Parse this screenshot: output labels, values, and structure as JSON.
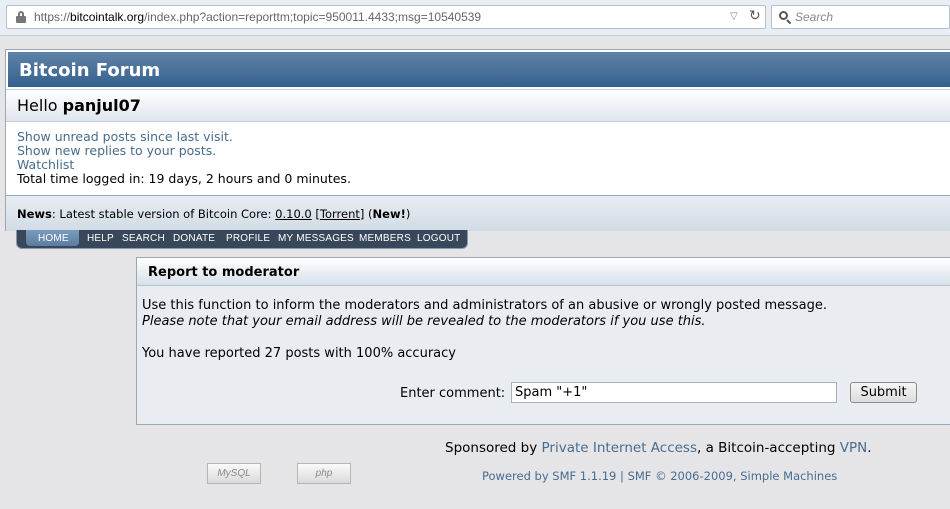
{
  "browser": {
    "url_prefix": "https://",
    "url_domain": "bitcointalk.org",
    "url_path": "/index.php?action=reporttm;topic=950011.4433;msg=10540539",
    "search_placeholder": "Search"
  },
  "header": {
    "forum_title": "Bitcoin Forum",
    "hello_prefix": "Hello ",
    "username": "panjul07"
  },
  "user_links": [
    "Show unread posts since last visit.",
    "Show new replies to your posts.",
    "Watchlist"
  ],
  "total_time": "Total time logged in: 19 days, 2 hours and 0 minutes.",
  "news": {
    "label": "News",
    "text": ": Latest stable version of Bitcoin Core: ",
    "version_link": "0.10.0",
    "bracket_open": " [",
    "torrent_link": "Torrent",
    "bracket_close": "] (",
    "new_label": "New!",
    "end": ")"
  },
  "menu": [
    "HOME",
    "HELP",
    "SEARCH",
    "DONATE",
    "PROFILE",
    "MY MESSAGES",
    "MEMBERS",
    "LOGOUT"
  ],
  "report": {
    "title": "Report to moderator",
    "description": "Use this function to inform the moderators and administrators of an abusive or wrongly posted message.",
    "notice": "Please note that your email address will be revealed to the moderators if you use this.",
    "count_text": "You have reported 27 posts with 100% accuracy",
    "comment_label": "Enter comment:",
    "comment_value": "Spam \"+1\"",
    "submit_label": "Submit"
  },
  "footer": {
    "sponsor_prefix": "Sponsored by ",
    "sponsor_link": "Private Internet Access",
    "sponsor_mid": ", a Bitcoin-accepting ",
    "vpn_link": "VPN",
    "sponsor_end": ".",
    "mysql_badge": "MySQL",
    "php_badge": "php",
    "powered_link": "Powered by SMF 1.1.19",
    "separator": " | ",
    "copyright_link": "SMF © 2006-2009, Simple Machines"
  }
}
